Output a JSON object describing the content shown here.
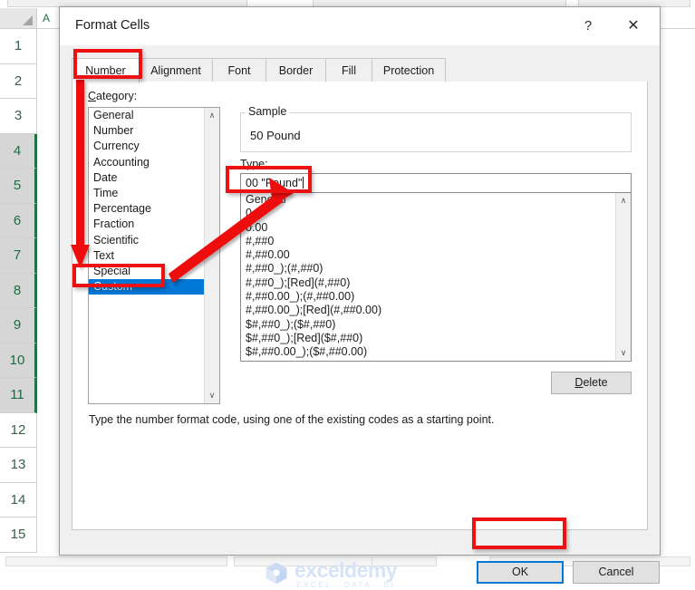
{
  "background": {
    "app": "excel-spreadsheet",
    "column_header": "A",
    "row_numbers": [
      "1",
      "2",
      "3",
      "4",
      "5",
      "6",
      "7",
      "8",
      "9",
      "10",
      "11",
      "12",
      "13",
      "14",
      "15"
    ],
    "selected_rows": [
      "4",
      "5",
      "6",
      "7",
      "8",
      "9",
      "10",
      "11"
    ],
    "selection_color": "#217346"
  },
  "dialog": {
    "title": "Format Cells",
    "help_icon": "?",
    "close_icon": "✕",
    "tabs": [
      {
        "label": "Number",
        "active": true
      },
      {
        "label": "Alignment",
        "active": false
      },
      {
        "label": "Font",
        "active": false
      },
      {
        "label": "Border",
        "active": false
      },
      {
        "label": "Fill",
        "active": false
      },
      {
        "label": "Protection",
        "active": false
      }
    ],
    "category": {
      "label": "Category:",
      "items": [
        "General",
        "Number",
        "Currency",
        "Accounting",
        "Date",
        "Time",
        "Percentage",
        "Fraction",
        "Scientific",
        "Text",
        "Special",
        "Custom"
      ],
      "selected": "Custom",
      "scroll_up_icon": "∧",
      "scroll_down_icon": "∨"
    },
    "sample": {
      "caption": "Sample",
      "value": "50 Pound"
    },
    "type": {
      "label": "Type:",
      "value": "00 \"Pound\""
    },
    "codes": {
      "items": [
        "General",
        "0",
        "0.00",
        "#,##0",
        "#,##0.00",
        "#,##0_);(#,##0)",
        "#,##0_);[Red](#,##0)",
        "#,##0.00_);(#,##0.00)",
        "#,##0.00_);[Red](#,##0.00)",
        "$#,##0_);($#,##0)",
        "$#,##0_);[Red]($#,##0)",
        "$#,##0.00_);($#,##0.00)"
      ],
      "scroll_up_icon": "∧",
      "scroll_down_icon": "∨"
    },
    "delete_label": "Delete",
    "description": "Type the number format code, using one of the existing codes as a starting point.",
    "ok_label": "OK",
    "cancel_label": "Cancel"
  },
  "watermark": {
    "brand": "exceldemy",
    "tagline": "EXCEL · DATA · BI"
  },
  "annotations": {
    "color": "#ee1111",
    "highlights": [
      "number-tab",
      "custom-category-item",
      "type-input",
      "ok-button"
    ],
    "arrows": [
      "number-tab-to-custom-category",
      "custom-category-to-type-input"
    ]
  }
}
